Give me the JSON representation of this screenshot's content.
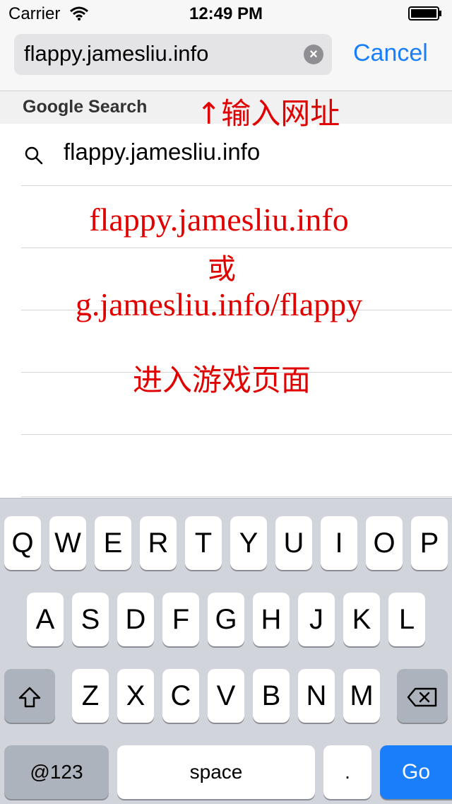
{
  "status_bar": {
    "carrier": "Carrier",
    "time": "12:49 PM"
  },
  "url_bar": {
    "value": "flappy.jamesliu.info",
    "clear_glyph": "×",
    "cancel_label": "Cancel"
  },
  "section": {
    "title": "Google Search"
  },
  "suggestion": {
    "text": "flappy.jamesliu.info"
  },
  "annotations": {
    "top": "↑输入网址",
    "line1": "flappy.jamesliu.info",
    "line2": "或",
    "line3": "g.jamesliu.info/flappy",
    "line4": "进入游戏页面"
  },
  "keyboard": {
    "row1": [
      "Q",
      "W",
      "E",
      "R",
      "T",
      "Y",
      "U",
      "I",
      "O",
      "P"
    ],
    "row2": [
      "A",
      "S",
      "D",
      "F",
      "G",
      "H",
      "J",
      "K",
      "L"
    ],
    "row3": [
      "Z",
      "X",
      "C",
      "V",
      "B",
      "N",
      "M"
    ],
    "numbers_label": "@123",
    "space_label": "space",
    "period_label": ".",
    "go_label": "Go"
  },
  "icons": {
    "wifi": "wifi-icon",
    "battery": "battery-icon",
    "search": "search-icon",
    "shift": "shift-icon",
    "backspace": "backspace-icon"
  },
  "colors": {
    "accent": "#1a7efb",
    "annotation": "#e00000"
  }
}
